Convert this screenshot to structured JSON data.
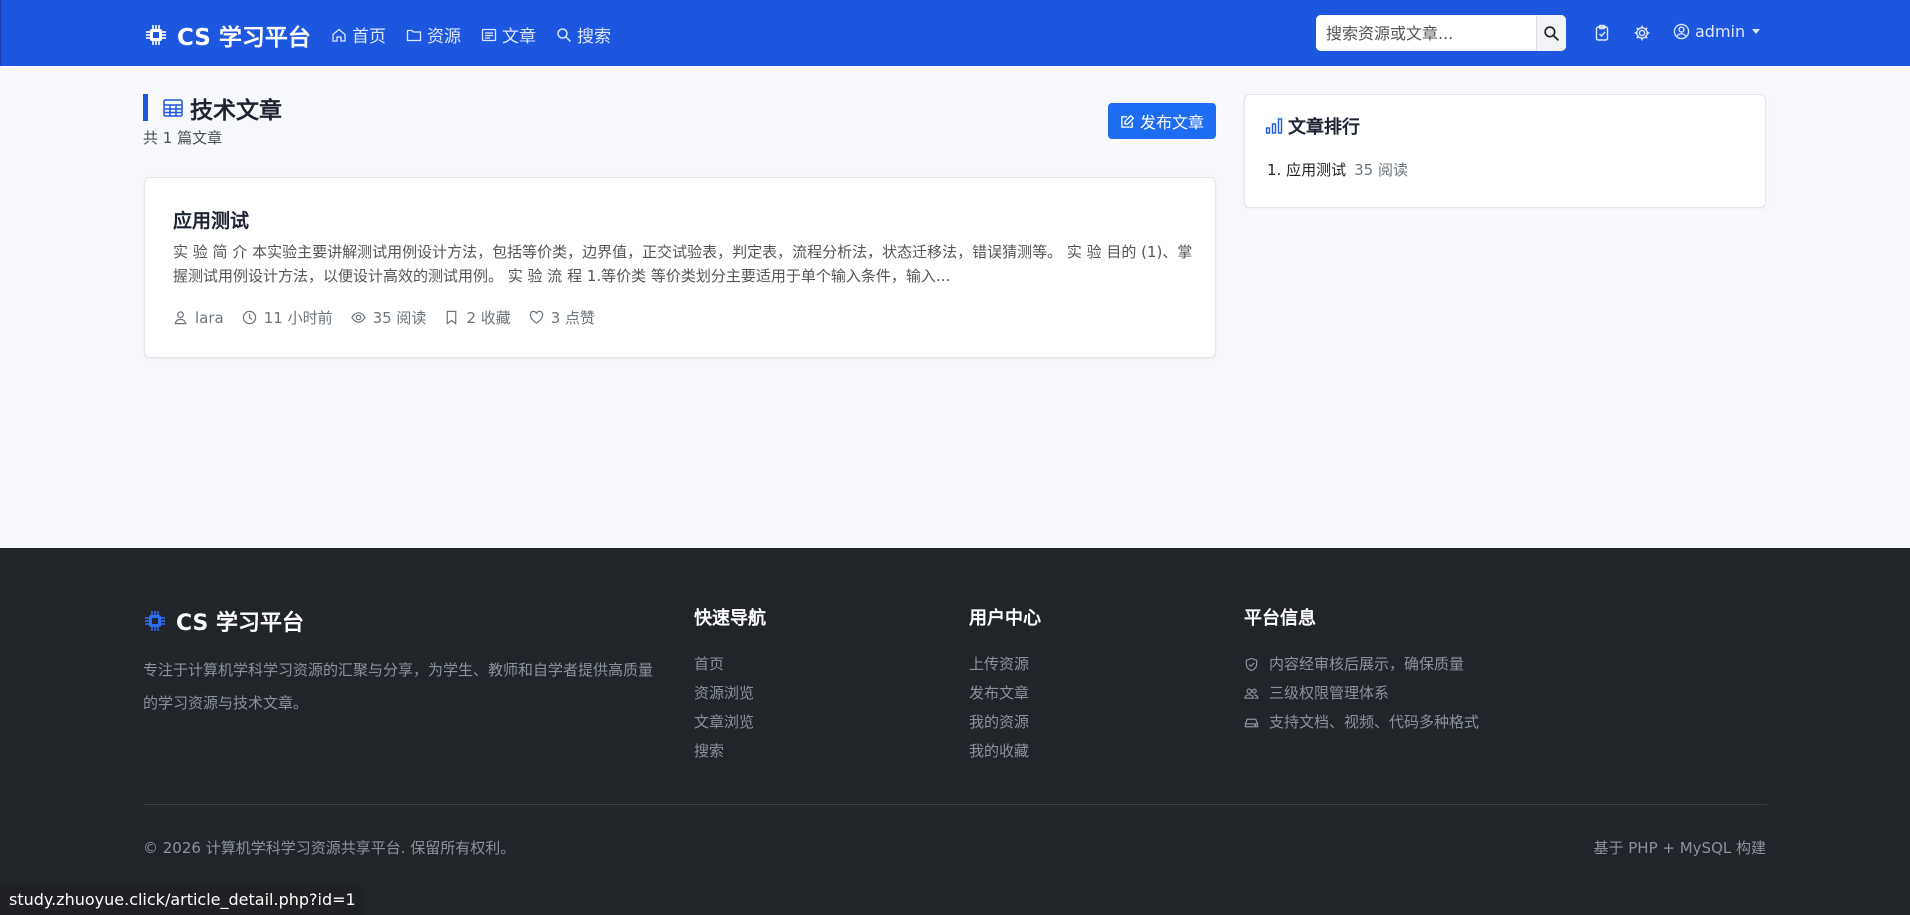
{
  "navbar": {
    "brand": "CS 学习平台",
    "links": [
      "首页",
      "资源",
      "文章",
      "搜索"
    ],
    "search_placeholder": "搜索资源或文章...",
    "user": "admin"
  },
  "main": {
    "section_title": "技术文章",
    "section_count": "共 1 篇文章",
    "publish_button": "发布文章",
    "article": {
      "title": "应用测试",
      "excerpt": "实 验 简 介 本实验主要讲解测试用例设计方法，包括等价类，边界值，正交试验表，判定表，流程分析法，状态迁移法，错误猜测等。 实 验 目的 (1)、掌握测试用例设计方法，以便设计高效的测试用例。 实 验 流 程 1.等价类 等价类划分主要适用于单个输入条件，输入...",
      "author": "lara",
      "time": "11 小时前",
      "reads": "35 阅读",
      "favorites": "2 收藏",
      "likes": "3 点赞"
    },
    "ranking": {
      "title": "文章排行",
      "items": [
        {
          "label": "1. 应用测试",
          "reads": "35 阅读"
        }
      ]
    }
  },
  "footer": {
    "brand": "CS 学习平台",
    "description": "专注于计算机学科学习资源的汇聚与分享，为学生、教师和自学者提供高质量的学习资源与技术文章。",
    "quick_nav": {
      "title": "快速导航",
      "links": [
        "首页",
        "资源浏览",
        "文章浏览",
        "搜索"
      ]
    },
    "user_center": {
      "title": "用户中心",
      "links": [
        "上传资源",
        "发布文章",
        "我的资源",
        "我的收藏"
      ]
    },
    "platform_info": {
      "title": "平台信息",
      "items": [
        "内容经审核后展示，确保质量",
        "三级权限管理体系",
        "支持文档、视频、代码多种格式"
      ]
    },
    "copyright": "© 2026 计算机学科学习资源共享平台. 保留所有权利。",
    "built_with": "基于 PHP + MySQL 构建"
  },
  "status_bar_url": "study.zhuoyue.click/article_detail.php?id=1",
  "colors": {
    "primary": "#1d57e0",
    "footer_bg": "#212529",
    "page_bg": "#f8f9fc"
  }
}
